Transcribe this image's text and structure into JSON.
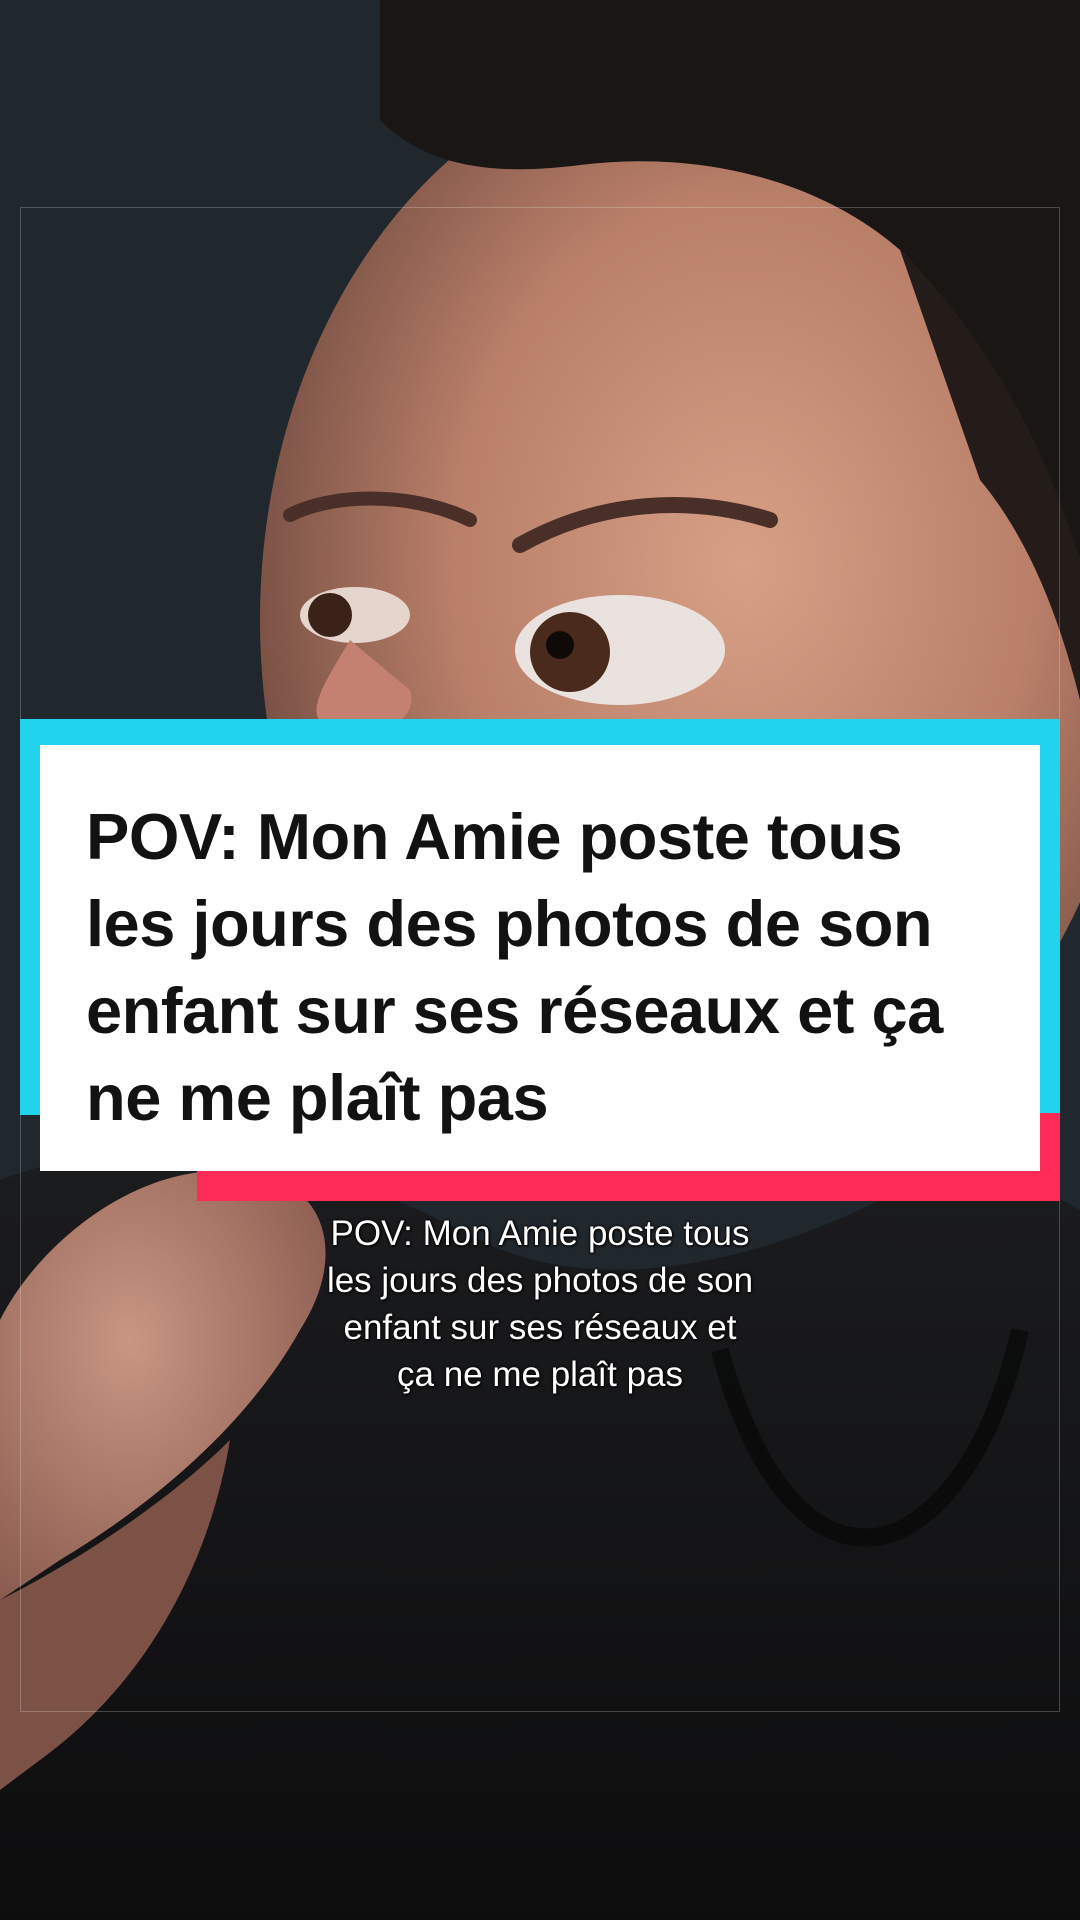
{
  "video": {
    "title_card_text": "POV: Mon Amie poste tous les jours des photos de son enfant sur ses réseaux et ça ne me plaît pas",
    "caption_lines": [
      "POV: Mon Amie poste tous",
      "les jours des photos de son",
      "enfant sur ses réseaux et",
      "ça ne me plaît pas"
    ]
  },
  "colors": {
    "card_background": "#ffffff",
    "accent_cyan": "#22d3ee",
    "accent_red": "#fd2b55",
    "text_dark": "#121212",
    "caption_text": "#ffffff"
  }
}
